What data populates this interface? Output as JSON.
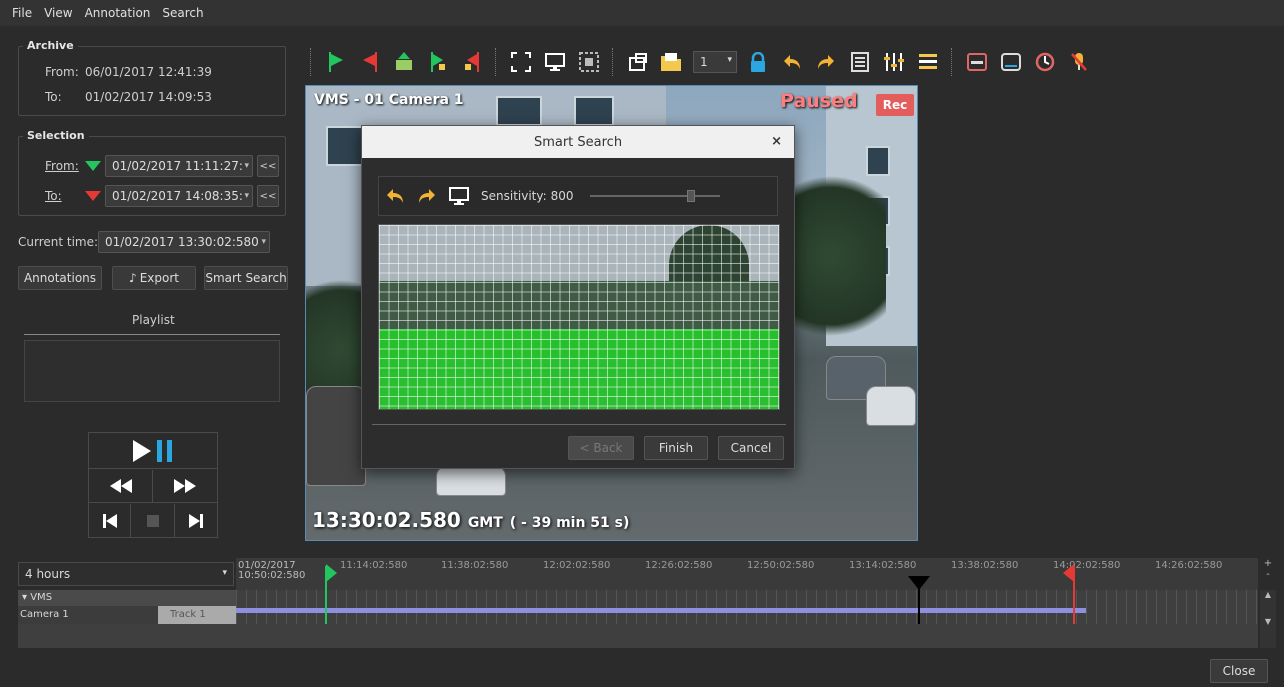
{
  "menu": [
    "File",
    "View",
    "Annotation",
    "Search"
  ],
  "archive": {
    "title": "Archive",
    "from_label": "From:",
    "from_value": "06/01/2017 12:41:39",
    "to_label": "To:",
    "to_value": "01/02/2017 14:09:53"
  },
  "selection": {
    "title": "Selection",
    "from_label": "From:",
    "from_value": "01/02/2017 11:11:27:",
    "to_label": "To:",
    "to_value": "01/02/2017 14:08:35:",
    "back_label": "<<"
  },
  "current_time": {
    "label": "Current time:",
    "value": "01/02/2017 13:30:02:580"
  },
  "actions": {
    "annotations": "Annotations",
    "export": "Export",
    "smart_search": "Smart Search"
  },
  "playlist": {
    "title": "Playlist"
  },
  "toolbar": {
    "layout_value": "1"
  },
  "video": {
    "camera_title": "VMS - 01 Camera 1",
    "status": "Paused",
    "rec": "Rec",
    "time": "13:30:02.580",
    "tz": "GMT",
    "offset": "( - 39 min 51 s)"
  },
  "dialog": {
    "title": "Smart Search",
    "close": "×",
    "sensitivity_label": "Sensitivity:",
    "sensitivity_value": "800",
    "sensitivity_fraction": 0.8,
    "back": "< Back",
    "finish": "Finish",
    "cancel": "Cancel"
  },
  "timeline": {
    "zoom": "4 hours",
    "start_date": "01/02/2017",
    "start_time": "10:50:02:580",
    "ticks": [
      "11:14:02:580",
      "11:38:02:580",
      "12:02:02:580",
      "12:26:02:580",
      "12:50:02:580",
      "13:14:02:580",
      "13:38:02:580",
      "14:02:02:580",
      "14:26:02:580"
    ],
    "group": "VMS",
    "camera": "Camera 1",
    "track": "Track 1"
  },
  "footer": {
    "close": "Close"
  },
  "colors": {
    "accent_blue": "#2aa7e0",
    "green_marker": "#22c55e",
    "red_marker": "#e53935",
    "paused_red": "#ff7d7d",
    "motion_green": "#22dc28"
  }
}
